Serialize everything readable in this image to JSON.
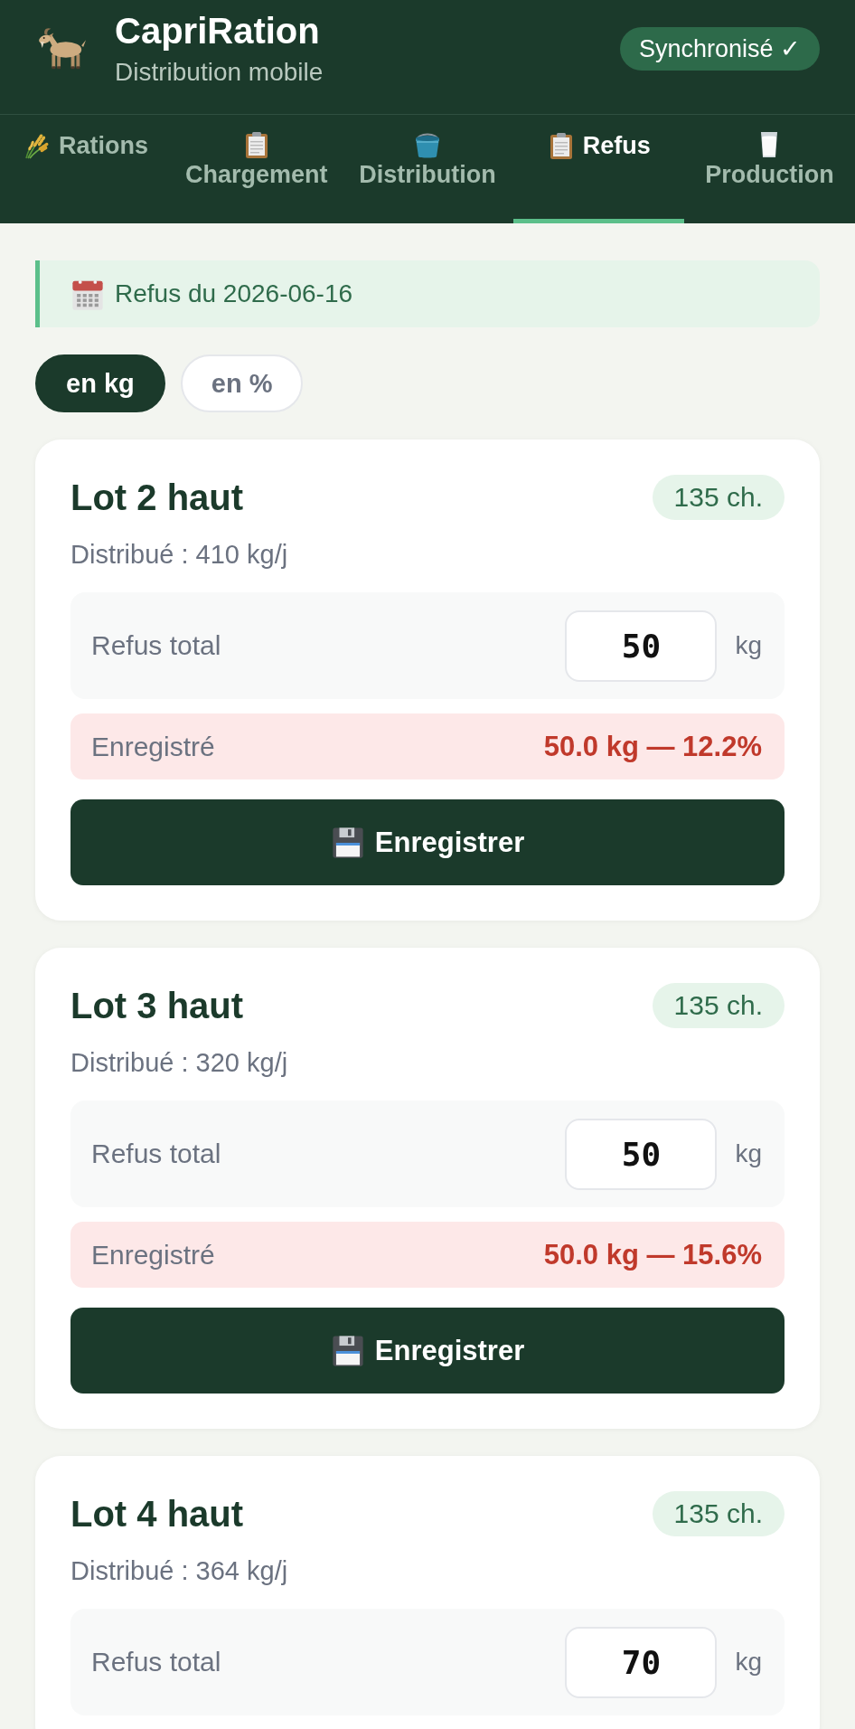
{
  "header": {
    "title": "CapriRation",
    "subtitle": "Distribution mobile",
    "sync_status": "Synchronisé ✓"
  },
  "tabs": [
    {
      "label": "Rations",
      "selected": false
    },
    {
      "label": "Chargement",
      "selected": false
    },
    {
      "label": "Distribution",
      "selected": false
    },
    {
      "label": "Refus",
      "selected": true
    },
    {
      "label": "Production",
      "selected": false
    }
  ],
  "date_banner": {
    "text": "Refus du 2026-06-16"
  },
  "unit_toggle": [
    {
      "label": "en kg",
      "selected": true
    },
    {
      "label": "en %",
      "selected": false
    }
  ],
  "lots": [
    {
      "name": "Lot 2 haut",
      "head_count": "135 ch.",
      "distributed": "Distribué : 410 kg/j",
      "refusal": {
        "label": "Refus total",
        "value": "50",
        "unit": "kg"
      },
      "saved": {
        "label": "Enregistré",
        "value": "50.0 kg — 12.2%"
      },
      "save_button": "Enregistrer"
    },
    {
      "name": "Lot 3 haut",
      "head_count": "135 ch.",
      "distributed": "Distribué : 320 kg/j",
      "refusal": {
        "label": "Refus total",
        "value": "50",
        "unit": "kg"
      },
      "saved": {
        "label": "Enregistré",
        "value": "50.0 kg — 15.6%"
      },
      "save_button": "Enregistrer"
    },
    {
      "name": "Lot 4 haut",
      "head_count": "135 ch.",
      "distributed": "Distribué : 364 kg/j",
      "refusal": {
        "label": "Refus total",
        "value": "70",
        "unit": "kg"
      }
    }
  ]
}
